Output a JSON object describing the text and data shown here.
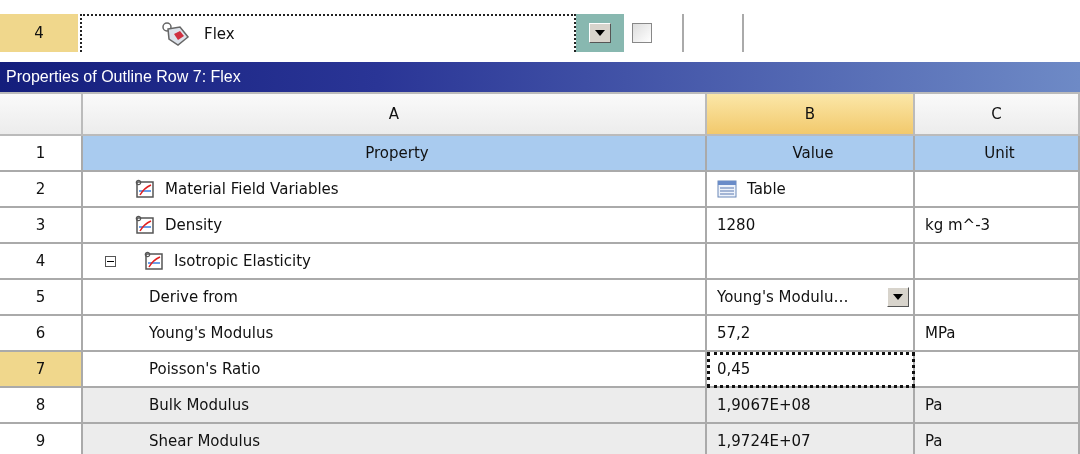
{
  "outline_row": {
    "number": "4",
    "label": "Flex",
    "selected": true,
    "checked": false
  },
  "panel": {
    "title": "Properties of Outline Row 7: Flex"
  },
  "columns": [
    {
      "selected": false
    },
    {
      "label": "A",
      "selected": false
    },
    {
      "label": "B",
      "selected": true
    },
    {
      "label": "C",
      "selected": false
    }
  ],
  "rows": [
    {
      "number": "1",
      "kind": "header",
      "property": "Property",
      "value": {
        "kind": "text",
        "text": "Value"
      },
      "unit": "Unit",
      "selected": false
    },
    {
      "number": "2",
      "kind": "property",
      "property": "Material Field Variables",
      "value": {
        "kind": "table",
        "text": "Table"
      },
      "selected": false,
      "readonly": false
    },
    {
      "number": "3",
      "kind": "property",
      "property": "Density",
      "value": {
        "kind": "text",
        "text": "1280"
      },
      "unit": "kg m^-3",
      "selected": false,
      "readonly": false
    },
    {
      "number": "4",
      "kind": "group",
      "expanded": true,
      "property": "Isotropic Elasticity",
      "selected": false,
      "readonly": false
    },
    {
      "number": "5",
      "kind": "sub",
      "property": "Derive from",
      "value": {
        "kind": "dropdown",
        "text": "Young's Modulu…"
      },
      "selected": false,
      "readonly": false
    },
    {
      "number": "6",
      "kind": "sub",
      "property": "Young's Modulus",
      "value": {
        "kind": "text",
        "text": "57,2"
      },
      "unit": "MPa",
      "selected": false,
      "readonly": false
    },
    {
      "number": "7",
      "kind": "sub",
      "property": "Poisson's Ratio",
      "value": {
        "kind": "text",
        "text": "0,45"
      },
      "selected": true,
      "readonly": false
    },
    {
      "number": "8",
      "kind": "sub",
      "property": "Bulk Modulus",
      "value": {
        "kind": "text",
        "text": "1,9067E+08"
      },
      "unit": "Pa",
      "selected": false,
      "readonly": true
    },
    {
      "number": "9",
      "kind": "sub",
      "property": "Shear Modulus",
      "value": {
        "kind": "text",
        "text": "1,9724E+07"
      },
      "unit": "Pa",
      "selected": false,
      "readonly": true
    }
  ]
}
